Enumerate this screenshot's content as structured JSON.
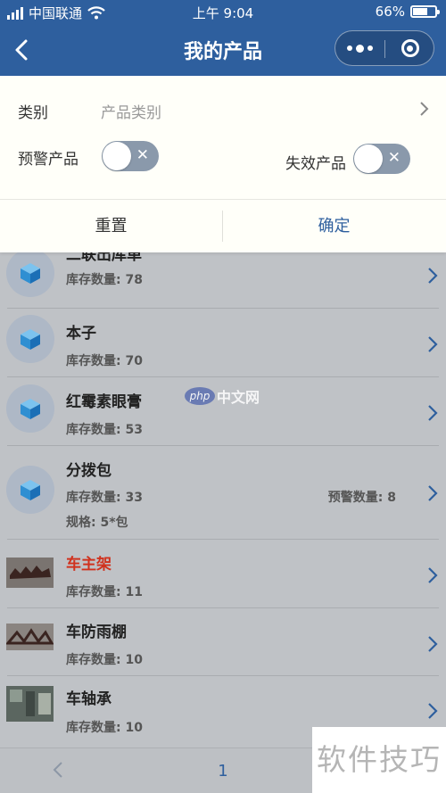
{
  "status_bar": {
    "carrier": "中国联通",
    "time": "上午 9:04",
    "battery": "66%",
    "battery_level": 0.66
  },
  "nav": {
    "title": "我的产品",
    "back_icon": "chevron-left-icon",
    "more_icon": "more-dots-icon",
    "close_icon": "target-circle-icon"
  },
  "filter": {
    "category_label": "类别",
    "category_placeholder": "产品类别",
    "warning_label": "预警产品",
    "warning_on": false,
    "invalid_label": "失效产品",
    "invalid_on": false,
    "toggle_off_glyph": "✕",
    "reset_label": "重置",
    "confirm_label": "确定"
  },
  "products": [
    {
      "name": "二联出库单",
      "stock_label": "库存数量: 78",
      "thumb": "cube-icon"
    },
    {
      "name": "本子",
      "stock_label": "库存数量: 70",
      "thumb": "cube-icon"
    },
    {
      "name": "红霉素眼膏",
      "stock_label": "库存数量: 53",
      "thumb": "cube-icon"
    },
    {
      "name": "分拨包",
      "stock_label": "库存数量: 33",
      "warn_label": "预警数量: 8",
      "spec_label": "规格: 5*包",
      "thumb": "cube-icon"
    },
    {
      "name": "车主架",
      "stock_label": "库存数量: 11",
      "thumb": "photo",
      "highlight": true
    },
    {
      "name": "车防雨棚",
      "stock_label": "库存数量: 10",
      "thumb": "photo"
    },
    {
      "name": "车轴承",
      "stock_label": "库存数量: 10",
      "thumb": "photo"
    }
  ],
  "pager": {
    "page": "1",
    "prev_icon": "chevron-left-icon"
  },
  "watermarks": {
    "center_logo": "php",
    "center_text": "中文网",
    "corner_text": "软件技巧"
  },
  "colors": {
    "primary": "#2e5f9e",
    "warning_text": "#d0321e",
    "toggle_off": "#8a99ab",
    "overlay": "#bfc2c6"
  }
}
